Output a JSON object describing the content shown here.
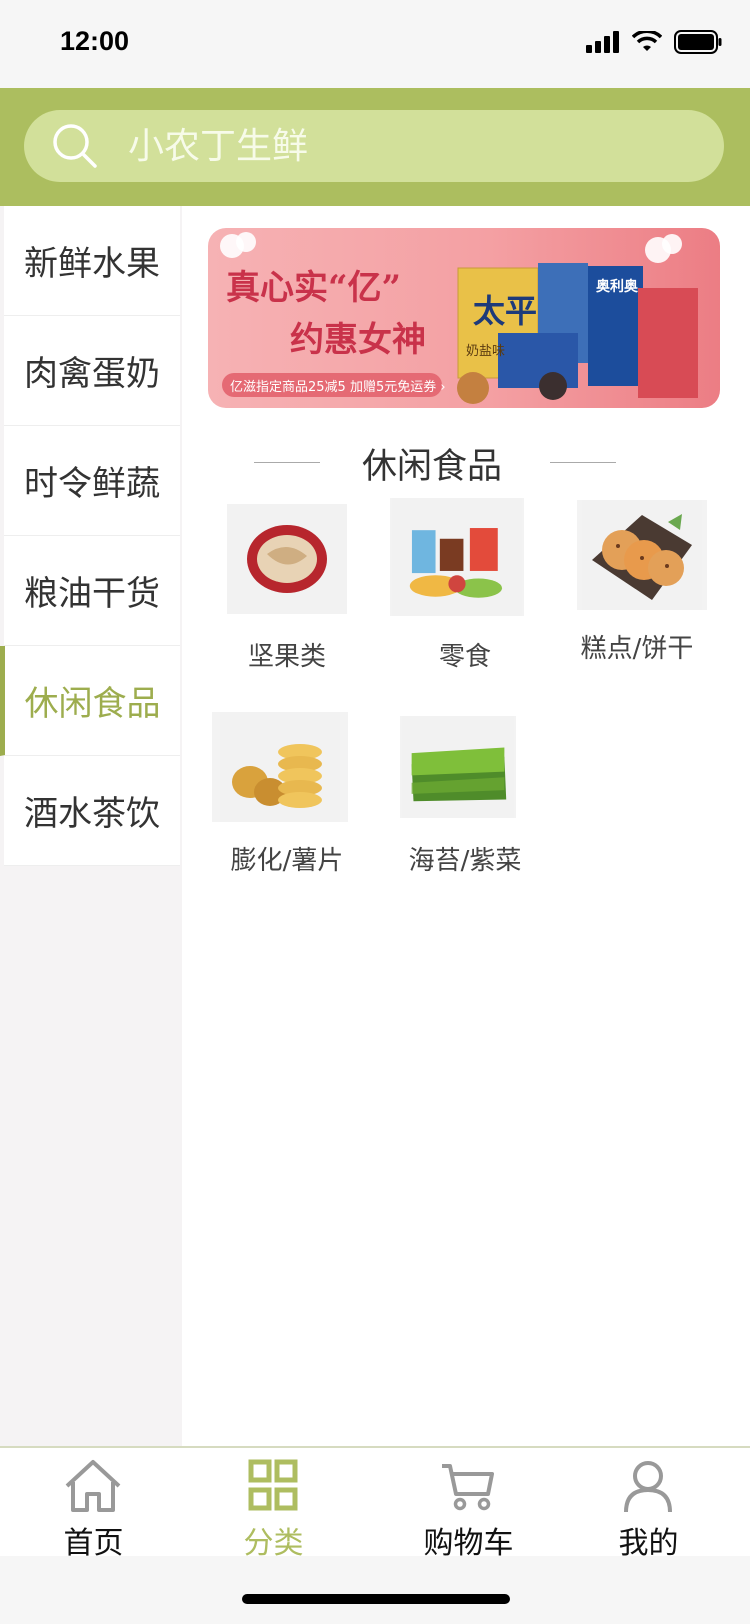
{
  "status_bar": {
    "time": "12:00"
  },
  "search": {
    "placeholder": "小农丁生鲜"
  },
  "sidebar": {
    "items": [
      {
        "label": "新鲜水果"
      },
      {
        "label": "肉禽蛋奶"
      },
      {
        "label": "时令鲜蔬"
      },
      {
        "label": "粮油干货"
      },
      {
        "label": "休闲食品",
        "active": true
      },
      {
        "label": "酒水茶饮"
      }
    ]
  },
  "banner": {
    "headline_1": "真心实“亿”",
    "headline_2": "约惠女神",
    "subline": "亿滋指定商品25减5 加赠5元免运券 ›",
    "brand_1": "太平",
    "brand_2": "奥利奥",
    "brand_3": "奶盐味"
  },
  "section": {
    "title": "休闲食品"
  },
  "categories": [
    {
      "label": "坚果类",
      "icon": "nut-image"
    },
    {
      "label": "零食",
      "icon": "snacks-image"
    },
    {
      "label": "糕点/饼干",
      "icon": "cookie-image"
    },
    {
      "label": "膨化/薯片",
      "icon": "chips-image"
    },
    {
      "label": "海苔/紫菜",
      "icon": "seaweed-image"
    }
  ],
  "tabbar": {
    "tabs": [
      {
        "label": "首页",
        "icon": "home-icon"
      },
      {
        "label": "分类",
        "icon": "grid-icon",
        "active": true
      },
      {
        "label": "购物车",
        "icon": "cart-icon"
      },
      {
        "label": "我的",
        "icon": "user-icon"
      }
    ]
  },
  "colors": {
    "accent": "#acbe5f",
    "active_text": "#9dad4e",
    "search_bg": "#d2e09a"
  }
}
